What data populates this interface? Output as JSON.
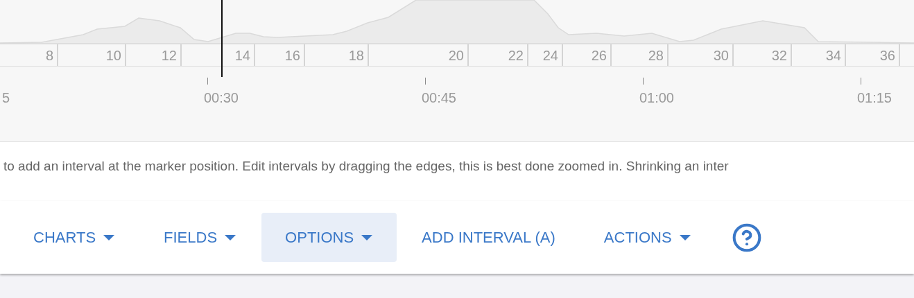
{
  "intervals": [
    "8",
    "10",
    "12",
    "14",
    "16",
    "18",
    "20",
    "22",
    "24",
    "26",
    "28",
    "30",
    "32",
    "34",
    "36"
  ],
  "time_axis": [
    "5",
    "00:30",
    "00:45",
    "01:00",
    "01:15"
  ],
  "hint": "to add an interval at the marker position. Edit intervals by dragging the edges, this is best done zoomed in. Shrinking an inter",
  "toolbar": [
    {
      "kind": "menu",
      "label": "CHARTS",
      "selected": false
    },
    {
      "kind": "menu",
      "label": "FIELDS",
      "selected": false
    },
    {
      "kind": "menu",
      "label": "OPTIONS",
      "selected": true
    },
    {
      "kind": "plain",
      "label": "ADD INTERVAL (A)",
      "selected": false
    },
    {
      "kind": "menu",
      "label": "ACTIONS",
      "selected": false
    },
    {
      "kind": "help",
      "selected": false
    }
  ]
}
